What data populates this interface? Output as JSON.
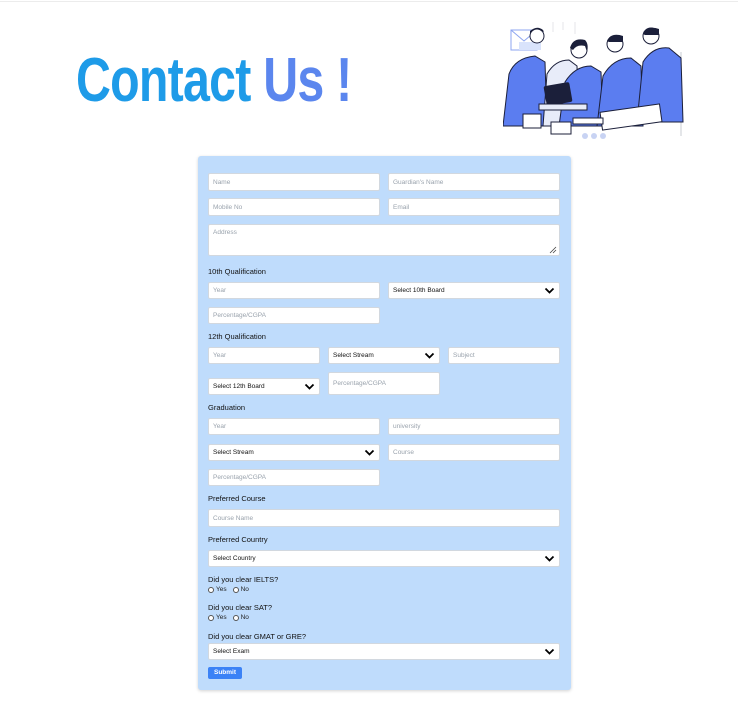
{
  "page": {
    "title_part1": "Contact ",
    "title_part2": "Us !",
    "accent": "#1e9be8",
    "accent2": "#5b86ee",
    "form_bg": "#bfdcfc",
    "submit_color": "#3b82f6"
  },
  "form": {
    "name_placeholder": "Name",
    "guardian_placeholder": "Guardian's Name",
    "mobile_placeholder": "Mobile No",
    "email_placeholder": "Email",
    "address_placeholder": "Address",
    "tenth": {
      "heading": "10th Qualification",
      "year_placeholder": "Year",
      "board_select": "Select 10th Board",
      "percentage_placeholder": "Percentage/CGPA"
    },
    "twelfth": {
      "heading": "12th Qualification",
      "year_placeholder": "Year",
      "stream_select": "Select Stream",
      "subject_placeholder": "Subject",
      "board_select": "Select 12th Board",
      "percentage_placeholder": "Percentage/CGPA"
    },
    "graduation": {
      "heading": "Graduation",
      "year_placeholder": "Year",
      "university_placeholder": "university",
      "stream_select": "Select Stream",
      "course_placeholder": "Course",
      "percentage_placeholder": "Percentage/CGPA"
    },
    "preferred_course": {
      "heading": "Preferred Course",
      "placeholder": "Course Name"
    },
    "preferred_country": {
      "heading": "Preferred Country",
      "select": "Select Country"
    },
    "ielts": {
      "question": "Did you clear IELTS?",
      "yes": "Yes",
      "no": "No"
    },
    "sat": {
      "question": "Did you clear SAT?",
      "yes": "Yes",
      "no": "No"
    },
    "gmat": {
      "question": "Did you clear GMAT or GRE?",
      "select": "Select Exam"
    },
    "submit_label": "Submit"
  }
}
